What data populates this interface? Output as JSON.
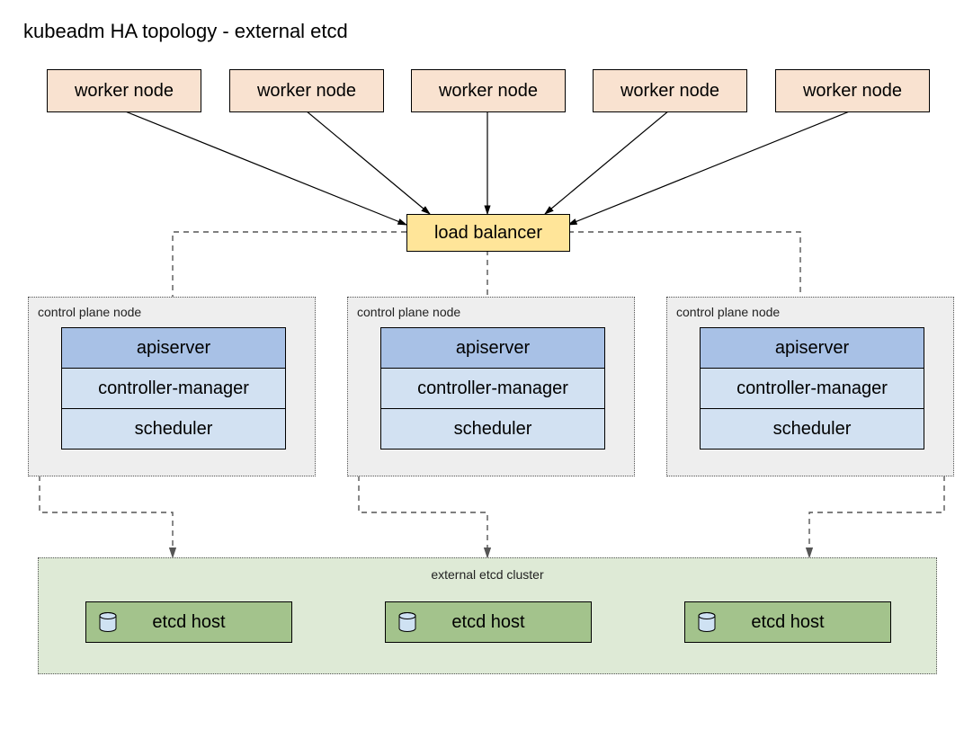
{
  "title": "kubeadm HA topology - external etcd",
  "workers": [
    {
      "label": "worker node"
    },
    {
      "label": "worker node"
    },
    {
      "label": "worker node"
    },
    {
      "label": "worker node"
    },
    {
      "label": "worker node"
    }
  ],
  "load_balancer": {
    "label": "load balancer"
  },
  "control_planes": [
    {
      "label": "control plane node",
      "components": {
        "apiserver": "apiserver",
        "controller_manager": "controller-manager",
        "scheduler": "scheduler"
      }
    },
    {
      "label": "control plane node",
      "components": {
        "apiserver": "apiserver",
        "controller_manager": "controller-manager",
        "scheduler": "scheduler"
      }
    },
    {
      "label": "control plane node",
      "components": {
        "apiserver": "apiserver",
        "controller_manager": "controller-manager",
        "scheduler": "scheduler"
      }
    }
  ],
  "etcd_cluster": {
    "label": "external etcd cluster",
    "hosts": [
      {
        "label": "etcd host"
      },
      {
        "label": "etcd host"
      },
      {
        "label": "etcd host"
      }
    ]
  }
}
